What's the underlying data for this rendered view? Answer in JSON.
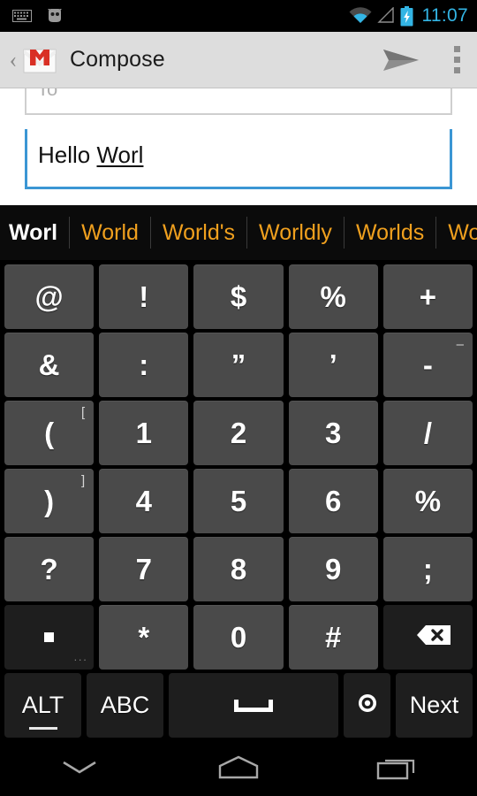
{
  "status_bar": {
    "time": "11:07",
    "time_color": "#33b5e5",
    "left_icons": [
      "keyboard-icon",
      "android-robot-icon"
    ],
    "right_icons": [
      "wifi-icon",
      "signal-icon",
      "battery-charging-icon"
    ]
  },
  "action_bar": {
    "back_label": "‹",
    "app_icon": "gmail-icon",
    "title": "Compose",
    "send_icon": "send-icon",
    "overflow_icon": "overflow-menu-icon"
  },
  "compose": {
    "to_value": "To",
    "subject_value": "Hello ",
    "subject_composing": "Worl",
    "focus_color": "#3b96d4"
  },
  "suggestions": {
    "typed": "Worl",
    "items": [
      "World",
      "World's",
      "Worldly",
      "Worlds",
      "Worldwide"
    ],
    "color": "#f0a01e",
    "typed_color": "#ffffff"
  },
  "keyboard": {
    "rows": [
      [
        {
          "main": "@"
        },
        {
          "main": "!"
        },
        {
          "main": "$"
        },
        {
          "main": "%"
        },
        {
          "main": "+"
        }
      ],
      [
        {
          "main": "&"
        },
        {
          "main": ":"
        },
        {
          "main": "”"
        },
        {
          "main": "’"
        },
        {
          "main": "-",
          "hint": "–"
        }
      ],
      [
        {
          "main": "(",
          "hint": "["
        },
        {
          "main": "1"
        },
        {
          "main": "2"
        },
        {
          "main": "3"
        },
        {
          "main": "/"
        }
      ],
      [
        {
          "main": ")",
          "hint": "]"
        },
        {
          "main": "4"
        },
        {
          "main": "5"
        },
        {
          "main": "6"
        },
        {
          "main": "%"
        }
      ],
      [
        {
          "main": "?"
        },
        {
          "main": "7"
        },
        {
          "main": "8"
        },
        {
          "main": "9"
        },
        {
          "main": ";"
        }
      ],
      [
        {
          "main": ".",
          "icon": "period-key",
          "dark": true,
          "dots": "···"
        },
        {
          "main": "*"
        },
        {
          "main": "0"
        },
        {
          "main": "#"
        },
        {
          "main": "",
          "icon": "backspace-icon",
          "dark": true
        }
      ]
    ],
    "bottom_row": [
      {
        "label": "ALT",
        "name": "alt-key",
        "underline": true
      },
      {
        "label": "ABC",
        "name": "abc-key"
      },
      {
        "label": "",
        "name": "space-key",
        "icon": "space-glyph"
      },
      {
        "label": "",
        "name": "mic-key",
        "icon": "voice-input-icon"
      },
      {
        "label": "Next",
        "name": "next-key"
      }
    ],
    "key_color": "#4a4a4a",
    "dark_key_color": "#1e1e1e",
    "background": "#000000"
  },
  "nav_bar": {
    "buttons": [
      {
        "name": "hide-keyboard-button",
        "icon": "chevron-down-icon"
      },
      {
        "name": "home-button",
        "icon": "home-icon"
      },
      {
        "name": "recents-button",
        "icon": "recents-icon"
      }
    ]
  }
}
